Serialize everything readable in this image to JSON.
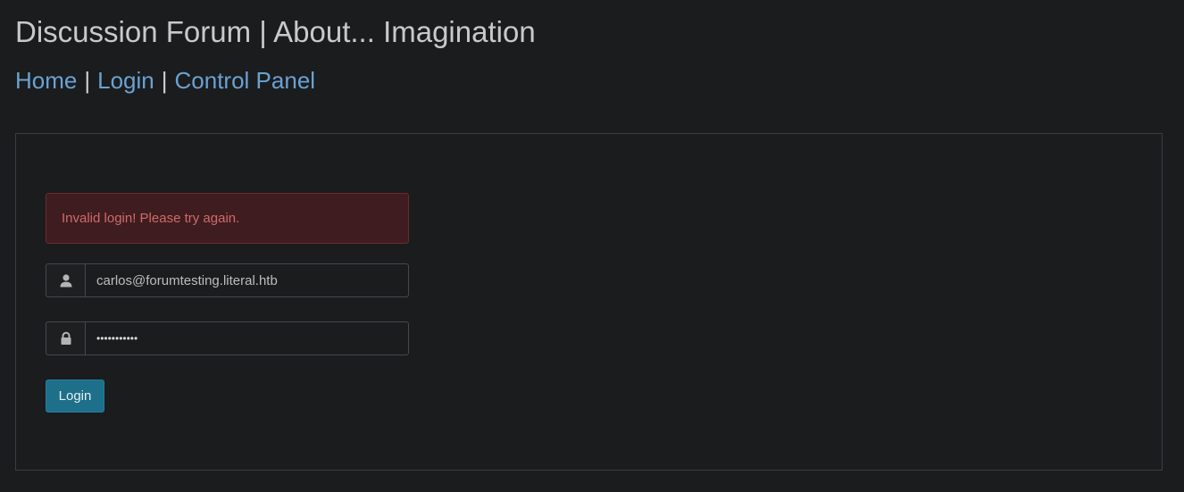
{
  "header": {
    "title": "Discussion Forum | About... Imagination"
  },
  "nav": {
    "items": [
      {
        "label": "Home"
      },
      {
        "label": "Login"
      },
      {
        "label": "Control Panel"
      }
    ],
    "separator": "|"
  },
  "login_form": {
    "error_message": "Invalid login! Please try again.",
    "username": {
      "value": "carlos@forumtesting.literal.htb",
      "icon": "user-icon"
    },
    "password": {
      "value": "•••••••••••",
      "icon": "lock-icon"
    },
    "submit_label": "Login"
  },
  "colors": {
    "background": "#1b1c1e",
    "link": "#6aa2d2",
    "alert_bg": "#3f1c1f",
    "alert_text": "#cf6a6a",
    "button": "#1d6f8a"
  }
}
